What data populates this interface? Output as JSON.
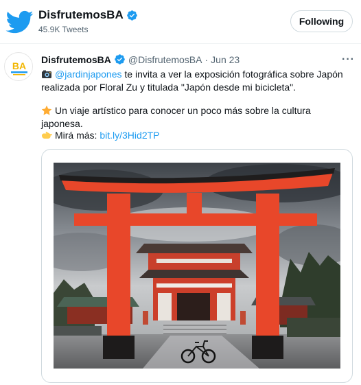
{
  "header": {
    "account_name": "DisfrutemosBA",
    "tweet_count": "45.9K Tweets",
    "follow_label": "Following"
  },
  "tweet": {
    "author_name": "DisfrutemosBA",
    "author_handle": "@DisfrutemosBA",
    "separator": "·",
    "date": "Jun 23",
    "more_label": "···",
    "avatar_text": "BA",
    "line1": {
      "mention": "@jardinjapones",
      "text_a": " te invita a ver la exposición fotográfica sobre Japón",
      "text_b": "realizada por Floral Zu y titulada \"Japón desde mi bicicleta\"."
    },
    "line2": "Un viaje artístico para conocer un poco más sobre la cultura japonesa.",
    "line3": {
      "prefix": "Mirá más: ",
      "link": "bit.ly/3Hid2TP"
    }
  },
  "colors": {
    "accent": "#1d9bf0",
    "torii": "#e8472a",
    "text": "#0f1419",
    "muted": "#536471"
  },
  "icons": {
    "brand": "twitter-bird-icon",
    "verified": "verified-badge-icon",
    "camera": "camera-emoji-icon",
    "star": "star-emoji-icon",
    "pointing": "pointing-hand-emoji-icon"
  }
}
